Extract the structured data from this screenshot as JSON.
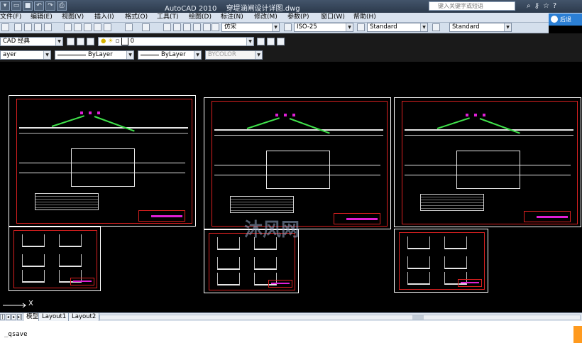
{
  "titlebar": {
    "app_title": "AutoCAD 2010",
    "file_name": "穿堤涵闸设计详图.dwg",
    "search_placeholder": "键入关键字或短语"
  },
  "menu": {
    "items": [
      "文件(F)",
      "编辑(E)",
      "视图(V)",
      "插入(I)",
      "格式(O)",
      "工具(T)",
      "绘图(D)",
      "标注(N)",
      "修改(M)",
      "参数(P)",
      "窗口(W)",
      "帮助(H)"
    ]
  },
  "help_chip": {
    "label": "后退"
  },
  "styles_toolbar": {
    "text_style": "仿宋",
    "dim_style": "ISO-25",
    "table_style": "Standard",
    "multileader_style": "Standard"
  },
  "workspace": {
    "name": "CAD 经典"
  },
  "layer": {
    "current": "0"
  },
  "properties": {
    "layer_label": "ayer",
    "linetype": "ByLayer",
    "lineweight": "ByLayer",
    "plotstyle": "BYCOLOR"
  },
  "watermark": {
    "text": "沐风网"
  },
  "ucs": {
    "axis_label": "X"
  },
  "layout_tabs": {
    "tabs": [
      "模型",
      "Layout1",
      "Layout2"
    ]
  },
  "command": {
    "text": "_qsave"
  },
  "colors": {
    "frame_red": "#d92020",
    "highlight_magenta": "#e01fd6",
    "highlight_green": "#3fe24a",
    "canvas_bg": "#000000",
    "menu_bg": "#d9e2ee"
  }
}
